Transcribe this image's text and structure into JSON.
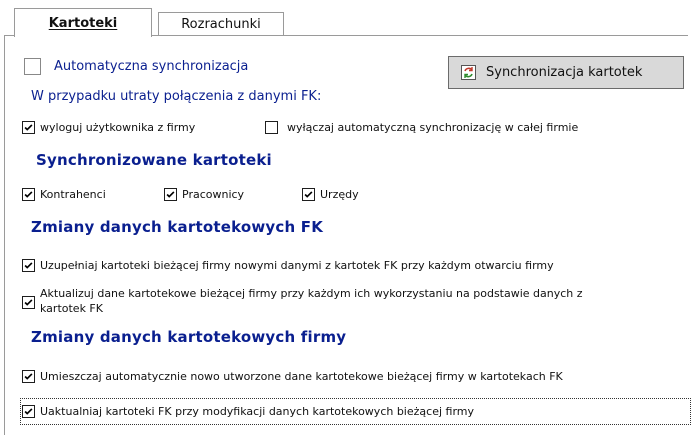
{
  "tabs": [
    {
      "label": "Kartoteki"
    },
    {
      "label": "Rozrachunki"
    }
  ],
  "auto_sync": {
    "label": "Automatyczna synchronizacja",
    "checked": false
  },
  "sync_button": {
    "label": "Synchronizacja kartotek",
    "icon": "sync-arrows-icon"
  },
  "connection_loss": {
    "heading": "W przypadku utraty połączenia z danymi FK:",
    "logout": {
      "label": "wyloguj użytkownika z firmy",
      "checked": true
    },
    "disable_sync": {
      "label": "wyłączaj automatyczną synchronizację w całej firmie",
      "checked": false
    }
  },
  "synced": {
    "heading": "Synchronizowane kartoteki",
    "items": [
      {
        "label": "Kontrahenci",
        "checked": true
      },
      {
        "label": "Pracownicy",
        "checked": true
      },
      {
        "label": "Urzędy",
        "checked": true
      }
    ]
  },
  "fk_changes": {
    "heading": "Zmiany danych kartotekowych FK",
    "supplement": {
      "label": "Uzupełniaj kartoteki bieżącej firmy nowymi danymi z kartotek FK przy każdym otwarciu firmy",
      "checked": true
    },
    "update_line1": "Aktualizuj dane kartotekowe bieżącej firmy przy każdym ich wykorzystaniu na podstawie danych z",
    "update_line2": "kartotek FK",
    "update_checked": true
  },
  "company_changes": {
    "heading": "Zmiany danych kartotekowych firmy",
    "place": {
      "label": "Umieszczaj automatycznie nowo utworzone dane kartotekowe bieżącej firmy w kartotekach FK",
      "checked": true
    },
    "update": {
      "label": "Uaktualniaj kartoteki FK przy modyfikacji danych kartotekowych bieżącej firmy",
      "checked": true
    }
  }
}
